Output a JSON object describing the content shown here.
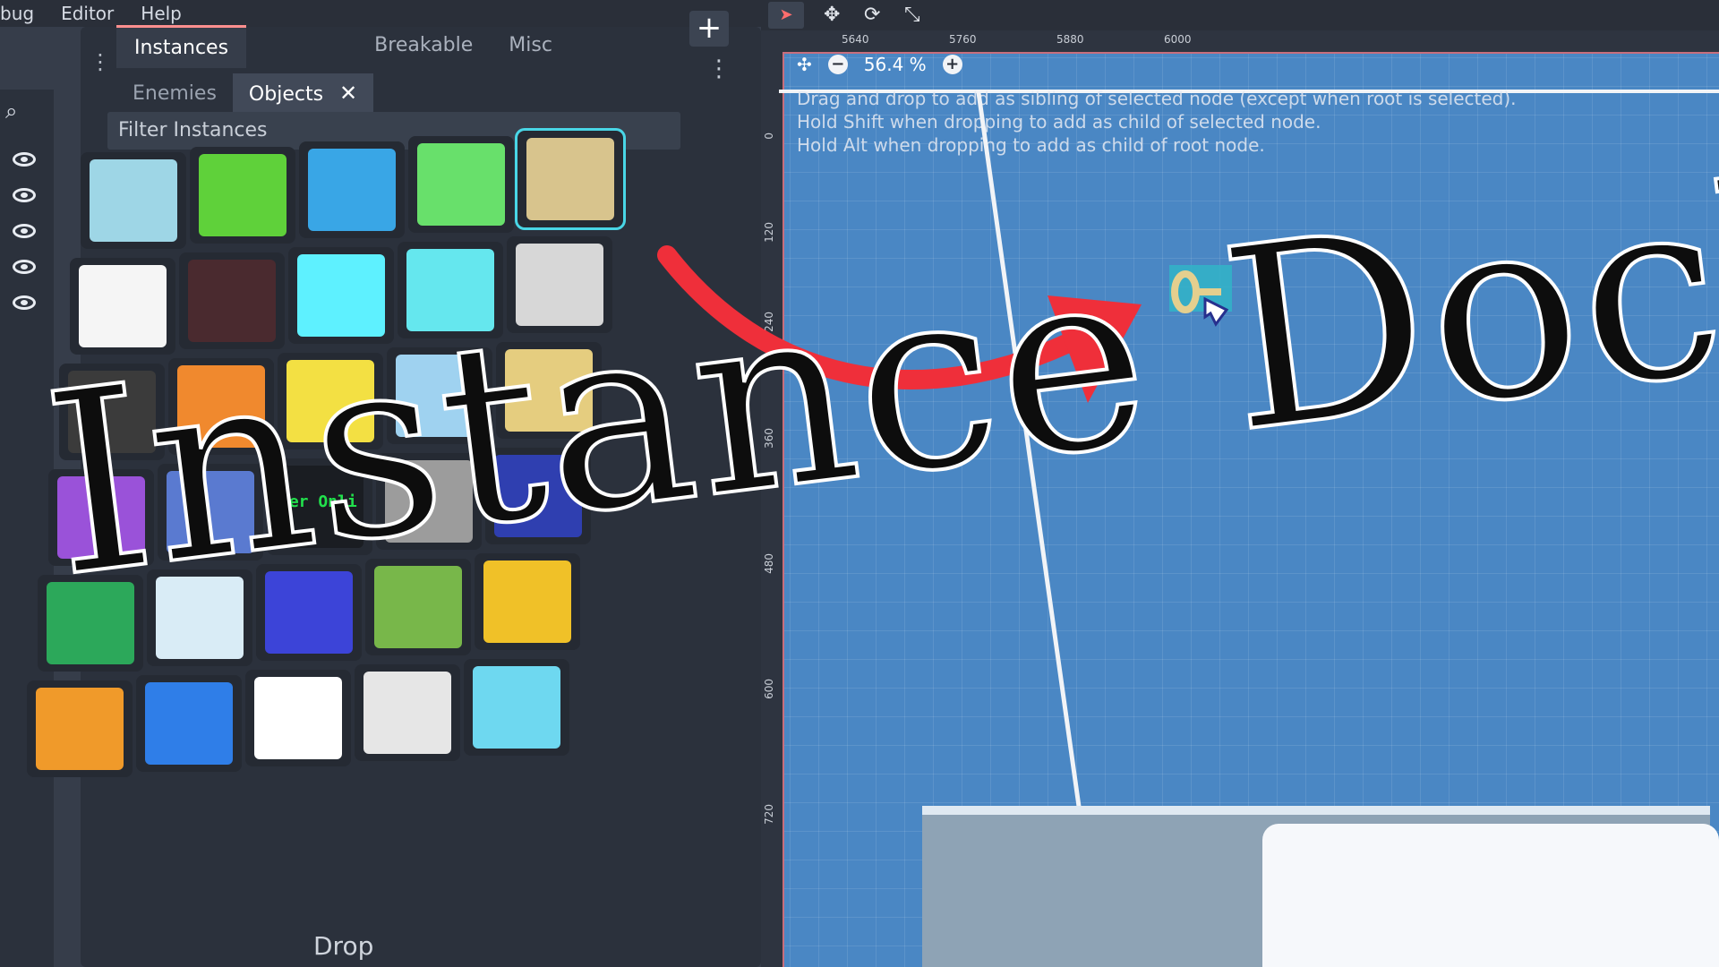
{
  "menu": {
    "items": [
      "bug",
      "Editor",
      "Help"
    ]
  },
  "dock": {
    "top_tabs": [
      "Instances",
      "Objects",
      "Breakable",
      "Misc"
    ],
    "sub_tabs": [
      "Enemies",
      "Objects"
    ],
    "active_top_tab": "Instances",
    "active_sub_tab": "Objects",
    "close_glyph": "✕",
    "add_glyph": "+",
    "menu_glyph": "⋮",
    "filter_placeholder": "Filter Instances",
    "tiles": [
      {
        "icon": "crystal-block-icon",
        "color": "#9ed6e6"
      },
      {
        "icon": "green-heart-coin-icon",
        "color": "#5fd13a"
      },
      {
        "icon": "blue-platform-icon",
        "color": "#39a6e6"
      },
      {
        "icon": "green-gem-icon",
        "color": "#68e06b"
      },
      {
        "icon": "gold-key-icon",
        "color": "#d8c48d"
      },
      {
        "icon": "pixel-key-icon",
        "color": "#f5f5f5"
      },
      {
        "icon": "dashed-block-outline-icon",
        "color": "#4a2a2f"
      },
      {
        "icon": "cyan-frame-block-icon",
        "color": "#5ef1ff"
      },
      {
        "icon": "cyan-switch-block-icon",
        "color": "#65e7ee"
      },
      {
        "icon": "brick-block-icon",
        "color": "#d7d7d7"
      },
      {
        "icon": "dark-spiked-frame-icon",
        "color": "#3b3b3b"
      },
      {
        "icon": "orange-ring-icon",
        "color": "#f0892e"
      },
      {
        "icon": "yellow-face-block-icon",
        "color": "#f3e043"
      },
      {
        "icon": "ice-block-icon",
        "color": "#9fd2f0"
      },
      {
        "icon": "keyhole-lock-icon",
        "color": "#e5cd7f"
      },
      {
        "icon": "purple-slope-icon",
        "color": "#9a52d9"
      },
      {
        "icon": "swirl-portal-icon",
        "color": "#5a7ad0"
      },
      {
        "icon": "text-sign-icon",
        "color": "#1a1d22"
      },
      {
        "icon": "striped-pillar-icon",
        "color": "#9c9c9c"
      },
      {
        "icon": "blue-oval-portal-icon",
        "color": "#2f3fb0"
      },
      {
        "icon": "green-slope-icon",
        "color": "#2ca85a"
      },
      {
        "icon": "white-crack-block-icon",
        "color": "#d9ecf6"
      },
      {
        "icon": "blue-streak-icon",
        "color": "#3c44d8"
      },
      {
        "icon": "leaf-icon",
        "color": "#78b74a"
      },
      {
        "icon": "fire-sprite-icon",
        "color": "#f0c128"
      },
      {
        "icon": "question-block-icon",
        "color": "#f09a2a"
      },
      {
        "icon": "blue-capsule-icon",
        "color": "#2f7ee8"
      },
      {
        "icon": "clock-block-icon",
        "color": "#ffffff"
      },
      {
        "icon": "small-clock-icon",
        "color": "#e6e6e6"
      },
      {
        "icon": "character-legs-icon",
        "color": "#6ed8f0"
      }
    ],
    "text_tile_label": "wer Onli",
    "drop_label": "Drop"
  },
  "viewport": {
    "zoom_label": "56.4 %",
    "zoom_out_glyph": "−",
    "zoom_in_glyph": "+",
    "ruler_top_ticks": [
      "5640",
      "5760",
      "5880",
      "6000"
    ],
    "ruler_left_ticks": [
      "0",
      "120",
      "240",
      "360",
      "480",
      "600",
      "720"
    ],
    "hints": [
      "Drag and drop to add as sibling of selected node (except when root is selected).",
      "Hold Shift when dropping to add as child of selected node.",
      "Hold Alt when dropping to add as child of root node."
    ]
  },
  "overlay": {
    "title": "Instance Dock",
    "arrow_color": "#ef2f3a"
  }
}
